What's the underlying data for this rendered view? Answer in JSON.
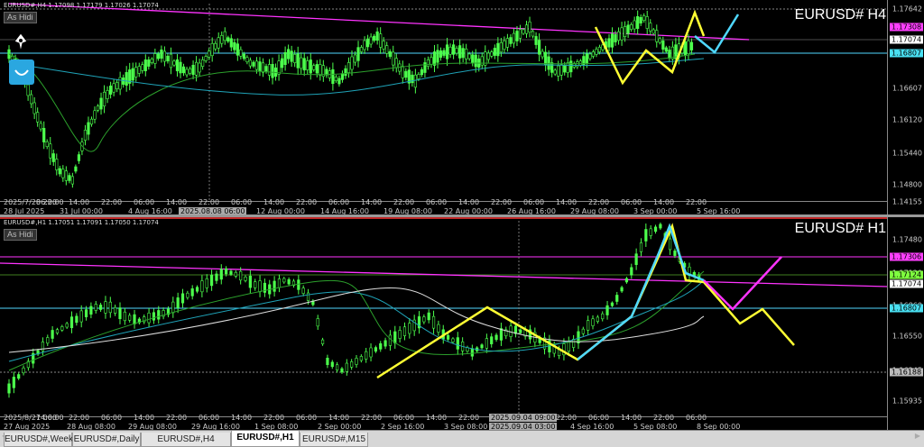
{
  "top": {
    "header": "EURUSD#,H4  1.17098 1.17179 1.17026 1.17074",
    "as_button": "As Hidi",
    "symbol_label": "EURUSD# H4",
    "price_labels": [
      "1.17642",
      "1.17308",
      "1.17074",
      "1.16807",
      "1.16607",
      "1.16120",
      "1.15440",
      "1.14800",
      "1.14155"
    ],
    "price_highlights": [
      {
        "text": "1.17308",
        "color": "#ff3fff"
      },
      {
        "text": "1.17074",
        "color": "#ffffff"
      },
      {
        "text": "1.16807",
        "color": "#49e0f2"
      }
    ],
    "time_labels": [
      "2025/7/28 22:00",
      "06:00",
      "14:00",
      "22:00",
      "06:00",
      "14:00",
      "22:00",
      "06:00",
      "14:00",
      "22:00",
      "06:00",
      "14:00",
      "22:00",
      "06:00",
      "14:00",
      "22:00",
      "06:00",
      "14:00",
      "22:00",
      "06:00",
      "14:00",
      "22:00"
    ],
    "time_labels_2": [
      "28 Jul 2025",
      "31 Jul 00:00",
      "4 Aug 16:00",
      "12 Aug 00:00",
      "14 Aug 16:00",
      "19 Aug 08:00",
      "22 Aug 00:00",
      "26 Aug 16:00",
      "29 Aug 08:00",
      "3 Sep 00:00",
      "5 Sep 16:00"
    ],
    "crosshair_label": "2025.08.08 06:00"
  },
  "bottom": {
    "header": "EURUSD#,H1  1.17051 1.17091 1.17050 1.17074",
    "as_button": "As Hidi",
    "symbol_label": "EURUSD# H1",
    "price_labels": [
      "1.17480",
      "1.17306",
      "1.17120",
      "1.16860",
      "1.16550",
      "1.16245",
      "1.15935"
    ],
    "price_highlights": [
      {
        "text": "1.17306",
        "color": "#ff3fff"
      },
      {
        "text": "1.17124",
        "color": "#7fff3f"
      },
      {
        "text": "1.17074",
        "color": "#ffffff"
      },
      {
        "text": "1.16807",
        "color": "#49e0f2"
      },
      {
        "text": "1.16188",
        "color": "#bbbbbb"
      }
    ],
    "time_labels": [
      "2025/8/27 06:00",
      "14:00",
      "22:00",
      "06:00",
      "14:00",
      "22:00",
      "06:00",
      "14:00",
      "22:00",
      "06:00",
      "14:00",
      "22:00",
      "06:00",
      "14:00",
      "22:00",
      "06:00",
      "14:00",
      "22:00",
      "06:00",
      "14:00",
      "22:00",
      "06:00"
    ],
    "time_labels_2": [
      "27 Aug 2025",
      "28 Aug 08:00",
      "29 Aug 08:00",
      "29 Aug 16:00",
      "1 Sep 08:00",
      "2 Sep 00:00",
      "2 Sep 16:00",
      "3 Sep 08:00",
      "4 Sep 16:00",
      "5 Sep 08:00",
      "8 Sep 00:00"
    ],
    "crosshair_label": "2025.09.04 09:00",
    "crosshair_label_2": "2025.09.04 03:00"
  },
  "tabs": [
    {
      "label": "EURUSD#,Weekly",
      "active": false
    },
    {
      "label": "EURUSD#,Daily",
      "active": false
    },
    {
      "label": "EURUSD#,H4",
      "active": false
    },
    {
      "label": "EURUSD#,H1",
      "active": true
    },
    {
      "label": "EURUSD#,M15",
      "active": false
    }
  ],
  "colors": {
    "bull": "#4cff4c",
    "ma_green": "#2ca02c",
    "ma_cyan": "#1fa3b8",
    "ma_white": "#dddddd",
    "magenta": "#ff33ff",
    "yellow": "#ffff33",
    "cyan": "#4fd8ff"
  }
}
